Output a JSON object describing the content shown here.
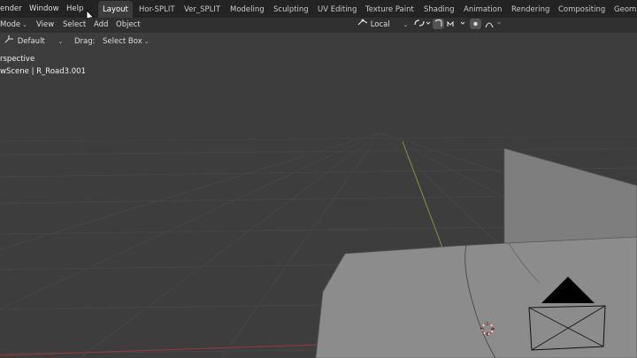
{
  "menu": {
    "render": "ender",
    "window": "Window",
    "help": "Help"
  },
  "workspaces": [
    "Layout",
    "Hor-SPLIT",
    "Ver_SPLIT",
    "Modeling",
    "Sculpting",
    "UV Editing",
    "Texture Paint",
    "Shading",
    "Animation",
    "Rendering",
    "Compositing",
    "Geom"
  ],
  "active_workspace": "Layout",
  "header": {
    "mode": "Mode",
    "view": "View",
    "select": "Select",
    "add": "Add",
    "object": "Object",
    "transform_orientation": "Local"
  },
  "toolbar": {
    "orientation": "Default",
    "drag_label": "Drag:",
    "drag_value": "Select Box"
  },
  "viewport": {
    "view_name": "rspective",
    "collection_info": "wScene | R_Road3.001"
  },
  "colors": {
    "topbar": "#232323",
    "header": "#303030",
    "viewport": "#3d3d3d",
    "x_axis": "#9c3838",
    "y_axis": "#7f9a2e",
    "mesh": "#8c8c8c"
  }
}
